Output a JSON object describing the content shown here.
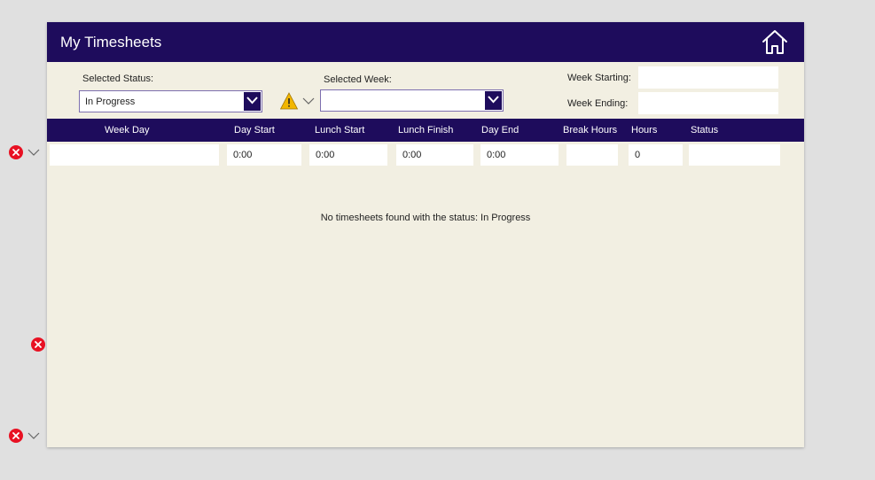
{
  "header": {
    "title": "My Timesheets",
    "home_icon": "home-icon"
  },
  "filters": {
    "status_label": "Selected Status:",
    "status_value": "In Progress",
    "week_label": "Selected Week:",
    "week_value": "",
    "week_starting_label": "Week Starting:",
    "week_starting_value": "",
    "week_ending_label": "Week Ending:",
    "week_ending_value": ""
  },
  "table": {
    "columns": [
      "Week Day",
      "Day Start",
      "Lunch Start",
      "Lunch Finish",
      "Day End",
      "Break Hours",
      "Hours",
      "Status"
    ],
    "row": {
      "week_day": "",
      "day_start": "0:00",
      "lunch_start": "0:00",
      "lunch_finish": "0:00",
      "day_end": "0:00",
      "break_hours": "",
      "hours": "0",
      "status": ""
    }
  },
  "empty_message": "No timesheets found with the status: In Progress",
  "colors": {
    "header": "#1e0c5c",
    "background": "#f2efe2",
    "error": "#e81123",
    "warning": "#f2b600"
  }
}
